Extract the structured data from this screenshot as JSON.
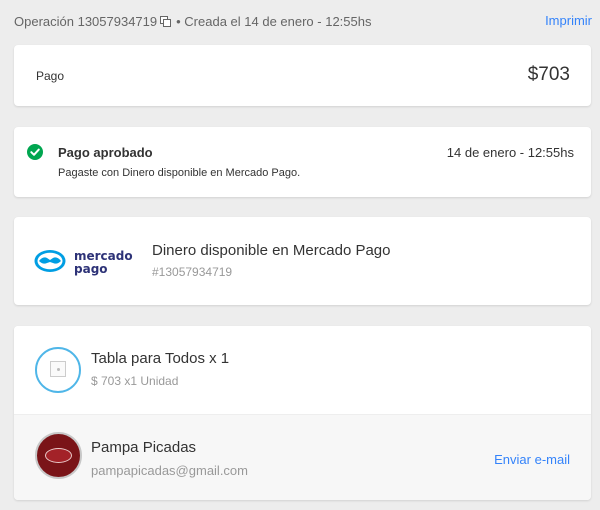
{
  "header": {
    "operation_label": "Operación 13057934719",
    "created_text": "• Creada el 14 de enero - 12:55hs",
    "print_label": "Imprimir"
  },
  "payment": {
    "label": "Pago",
    "amount": "$703"
  },
  "status": {
    "title": "Pago aprobado",
    "date": "14 de enero - 12:55hs",
    "description": "Pagaste con Dinero disponible en Mercado Pago.",
    "icon": "check-circle-icon",
    "color": "#00a650"
  },
  "method": {
    "logo_line1": "mercado",
    "logo_line2": "pago",
    "title": "Dinero disponible en Mercado Pago",
    "id": "#13057934719",
    "brand_color": "#009ee3",
    "logo_text_color": "#2d3277"
  },
  "item": {
    "title": "Tabla para Todos x 1",
    "subtitle": "$ 703 x1 Unidad"
  },
  "seller": {
    "name": "Pampa Picadas",
    "email": "pampapicadas@gmail.com",
    "send_email_label": "Enviar e-mail"
  },
  "colors": {
    "link": "#3483fa",
    "background": "#ededed"
  }
}
